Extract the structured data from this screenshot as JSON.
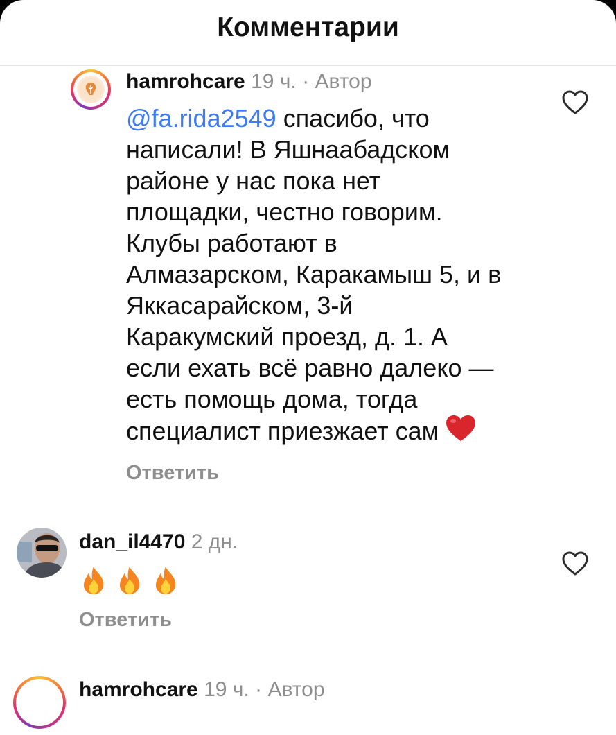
{
  "header": {
    "title": "Комментарии"
  },
  "comments": [
    {
      "username": "hamrohcare",
      "time": "19 ч.",
      "separator": " · ",
      "badge": "Автор",
      "mention": "@fa.rida2549",
      "text": " спасибо, что\nнаписали! В Яшнаабадском\nрайоне у нас пока нет\nплощадки, честно говорим.\nКлубы работают в\nАлмазарском, Каракамыш 5, и в\nЯккасарайском, 3-й\nКаракумский проезд, д. 1. А\nесли ехать всё равно далеко —\nесть помощь дома, тогда\nспециалист приезжает сам ",
      "trailing_emoji": "red-heart",
      "reply_label": "Ответить",
      "like_icon": "heart-outline-icon"
    },
    {
      "username": "dan_il4470",
      "time": "2 дн.",
      "emojis": [
        "fire",
        "fire",
        "fire"
      ],
      "reply_label": "Ответить",
      "like_icon": "heart-outline-icon"
    },
    {
      "username": "hamrohcare",
      "time": "19 ч.",
      "separator": " · ",
      "badge": "Автор"
    }
  ],
  "colors": {
    "mention": "#3b7bf6",
    "muted": "#8e8e8e",
    "text": "#111111",
    "heart": "#d9262c"
  }
}
